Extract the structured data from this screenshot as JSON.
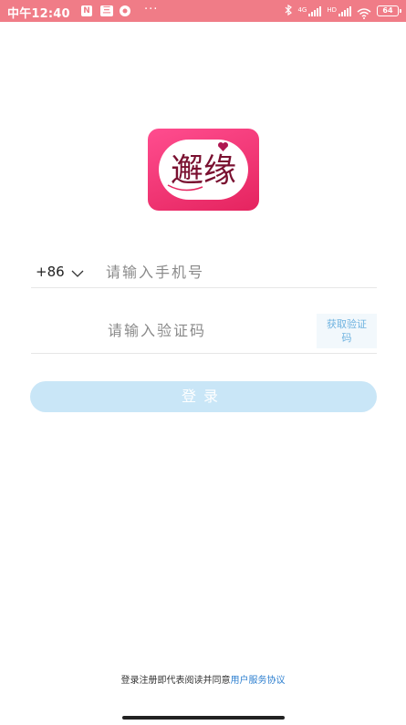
{
  "status_bar": {
    "time": "中午12:40",
    "notif_n": "N",
    "notif_3": "三",
    "dots": "···",
    "signal_labels": [
      "4G",
      "HD"
    ],
    "battery": "64"
  },
  "logo": {
    "text": "邂缘",
    "colors": {
      "top": "#ff4d8f",
      "bottom": "#e5245f"
    }
  },
  "phone": {
    "country_code": "+86",
    "placeholder": "请输入手机号",
    "value": ""
  },
  "code": {
    "placeholder": "请输入验证码",
    "value": "",
    "get_code_label": "获取验证码"
  },
  "login_button": "登录",
  "agreement": {
    "prefix": "登录注册即代表阅读并同意",
    "link": "用户服务协议"
  },
  "colors": {
    "status_bar": "#f07c87",
    "login_button_bg": "#c9e6f7",
    "link": "#2f80d0",
    "get_code_text": "#6fb3e0"
  }
}
